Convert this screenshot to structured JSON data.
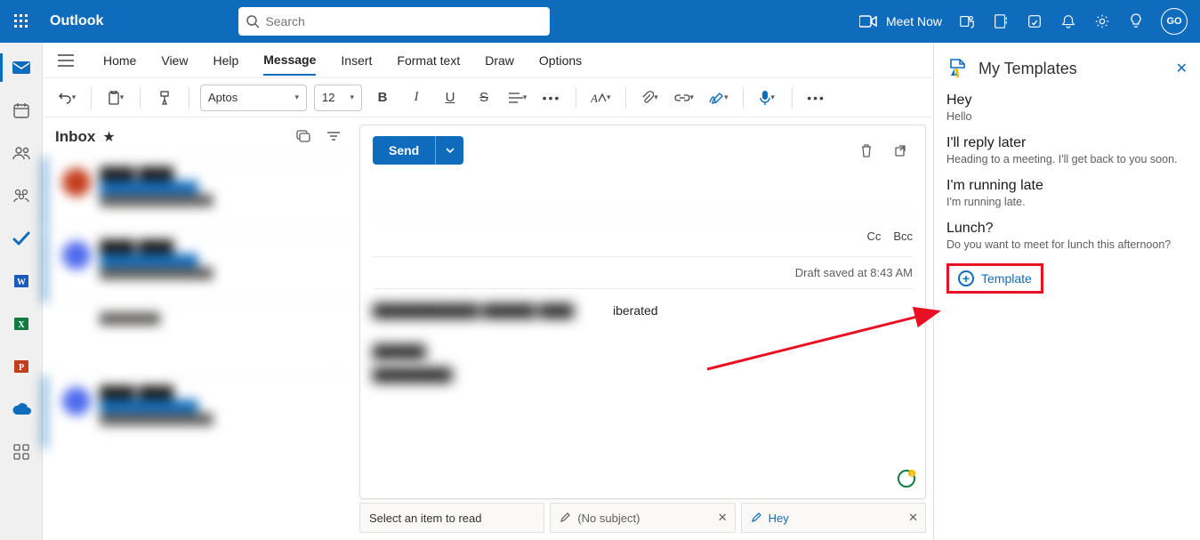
{
  "topbar": {
    "brand": "Outlook",
    "search_placeholder": "Search",
    "meet_now": "Meet Now",
    "avatar_initials": "GO"
  },
  "tabs": {
    "items": [
      "Home",
      "View",
      "Help",
      "Message",
      "Insert",
      "Format text",
      "Draw",
      "Options"
    ],
    "active_index": 3
  },
  "ribbon": {
    "font_name": "Aptos",
    "font_size": "12"
  },
  "msglist": {
    "title": "Inbox"
  },
  "compose": {
    "send_label": "Send",
    "cc_label": "Cc",
    "bcc_label": "Bcc",
    "status": "Draft saved at 8:43 AM",
    "body_fragment": "iberated"
  },
  "bottom_tabs": {
    "placeholder": "Select an item to read",
    "tab1": "(No subject)",
    "tab2": "Hey"
  },
  "templates_pane": {
    "title": "My Templates",
    "items": [
      {
        "title": "Hey",
        "sub": "Hello"
      },
      {
        "title": "I'll reply later",
        "sub": "Heading to a meeting. I'll get back to you soon."
      },
      {
        "title": "I'm running late",
        "sub": "I'm running late."
      },
      {
        "title": "Lunch?",
        "sub": "Do you want to meet for lunch this afternoon?"
      }
    ],
    "add_label": "Template"
  }
}
